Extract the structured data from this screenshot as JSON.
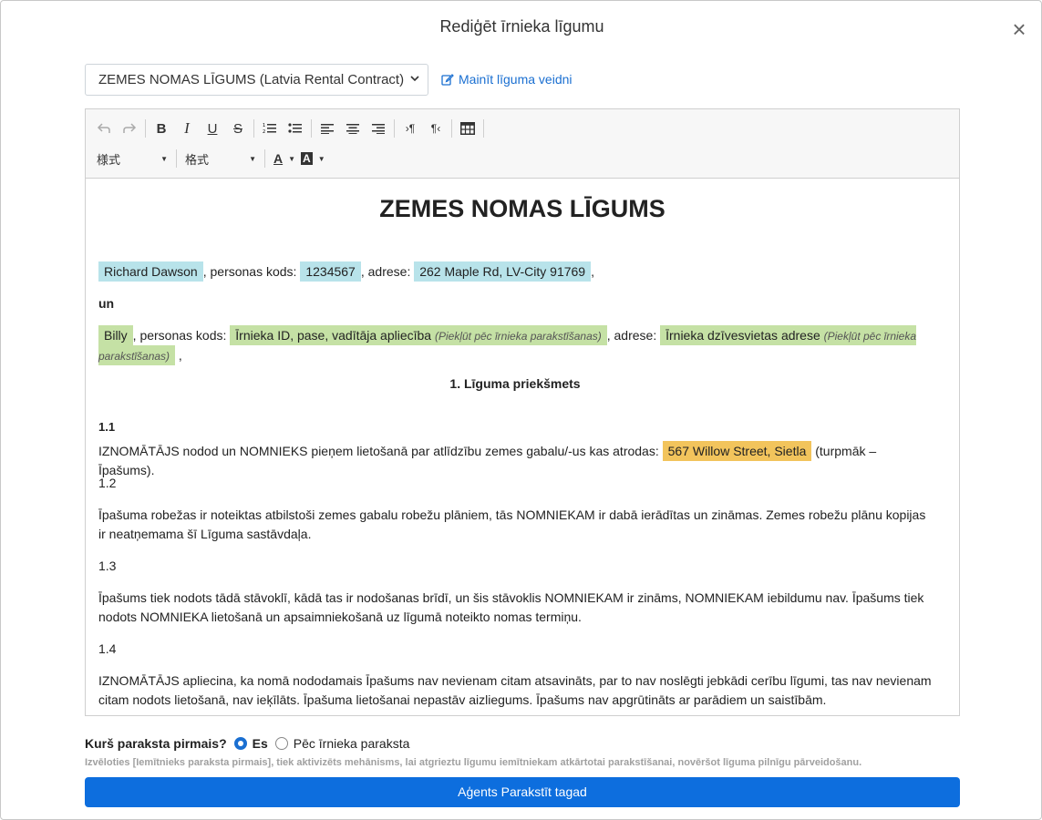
{
  "modal": {
    "title": "Rediģēt īrnieka līgumu",
    "close": "×"
  },
  "template": {
    "selected": "ZEMES NOMAS LĪGUMS (Latvia Rental Contract)",
    "change_link": "Mainīt līguma veidni"
  },
  "toolbar": {
    "style_label": "様式",
    "format_label": "格式",
    "buttons": [
      "undo-icon",
      "redo-icon",
      "bold-icon",
      "italic-icon",
      "underline-icon",
      "strikethrough-icon",
      "ordered-list-icon",
      "unordered-list-icon",
      "align-left-icon",
      "align-center-icon",
      "align-right-icon",
      "ltr-icon",
      "rtl-icon",
      "table-icon",
      "font-color-icon",
      "background-color-icon"
    ]
  },
  "document": {
    "title": "ZEMES NOMAS LĪGUMS",
    "landlord_name": "Richard Dawson",
    "personal_code_label": ", personas kods: ",
    "landlord_code": "1234567",
    "address_label": ",  adrese: ",
    "landlord_address": "262 Maple Rd, LV-City 91769",
    "comma": ",",
    "and": "un",
    "tenant_name": "Billy",
    "tenant_code_label": ", personas kods: ",
    "tenant_id": "Īrnieka ID, pase, vadītāja apliecība",
    "tenant_id_note": "(Piekļūt pēc īrnieka parakstīšanas)",
    "tenant_address_label": ", adrese: ",
    "tenant_address": "Īrnieka dzīvesvietas adrese",
    "tenant_address_note": "(Piekļūt pēc īrnieka parakstīšanas)",
    "section1_title": "1. Līguma priekšmets",
    "s11_num": "1.1",
    "s11_text_a": "IZNOMĀTĀJS nodod un NOMNIEKS pieņem lietošanā par atlīdzību zemes gabalu/-us kas atrodas: ",
    "property_address": "567 Willow Street, Sietla",
    "s11_text_b": " (turpmāk – Īpašums).",
    "s12_num": "1.2",
    "s12_text": "Īpašuma robežas ir noteiktas atbilstoši zemes gabalu robežu plāniem, tās NOMNIEKAM ir dabā ierādītas un zināmas. Zemes robežu plānu kopijas ir neatņemama šī Līguma sastāvdaļa.",
    "s13_num": "1.3",
    "s13_text": "Īpašums tiek nodots tādā stāvoklī, kādā tas ir nodošanas brīdī, un šis stāvoklis NOMNIEKAM ir zināms, NOMNIEKAM iebildumu nav. Īpašums tiek nodots NOMNIEKA lietošanā un apsaimniekošanā uz līgumā noteikto nomas termiņu.",
    "s14_num": "1.4",
    "s14_text": "IZNOMĀTĀJS apliecina, ka nomā nododamais Īpašums nav nevienam citam atsavināts, par to nav noslēgti jebkādi cerību līgumi, tas nav nevienam citam nodots lietošanā, nav ieķīlāts.  Īpašuma lietošanai nepastāv aizliegums. Īpašums nav apgrūtināts ar parādiem un saistībām."
  },
  "signing": {
    "question": "Kurš paraksta pirmais?",
    "option_me": "Es",
    "option_after": "Pēc īrnieka paraksta",
    "selected": "Es",
    "hint": "Izvēloties [Iemītnieks paraksta pirmais], tiek aktivizēts mehānisms, lai atgrieztu līgumu iemītniekam atkārtotai parakstīšanai, novēršot līguma pilnīgu pārveidošanu.",
    "submit": "Aģents Parakstīt tagad"
  }
}
